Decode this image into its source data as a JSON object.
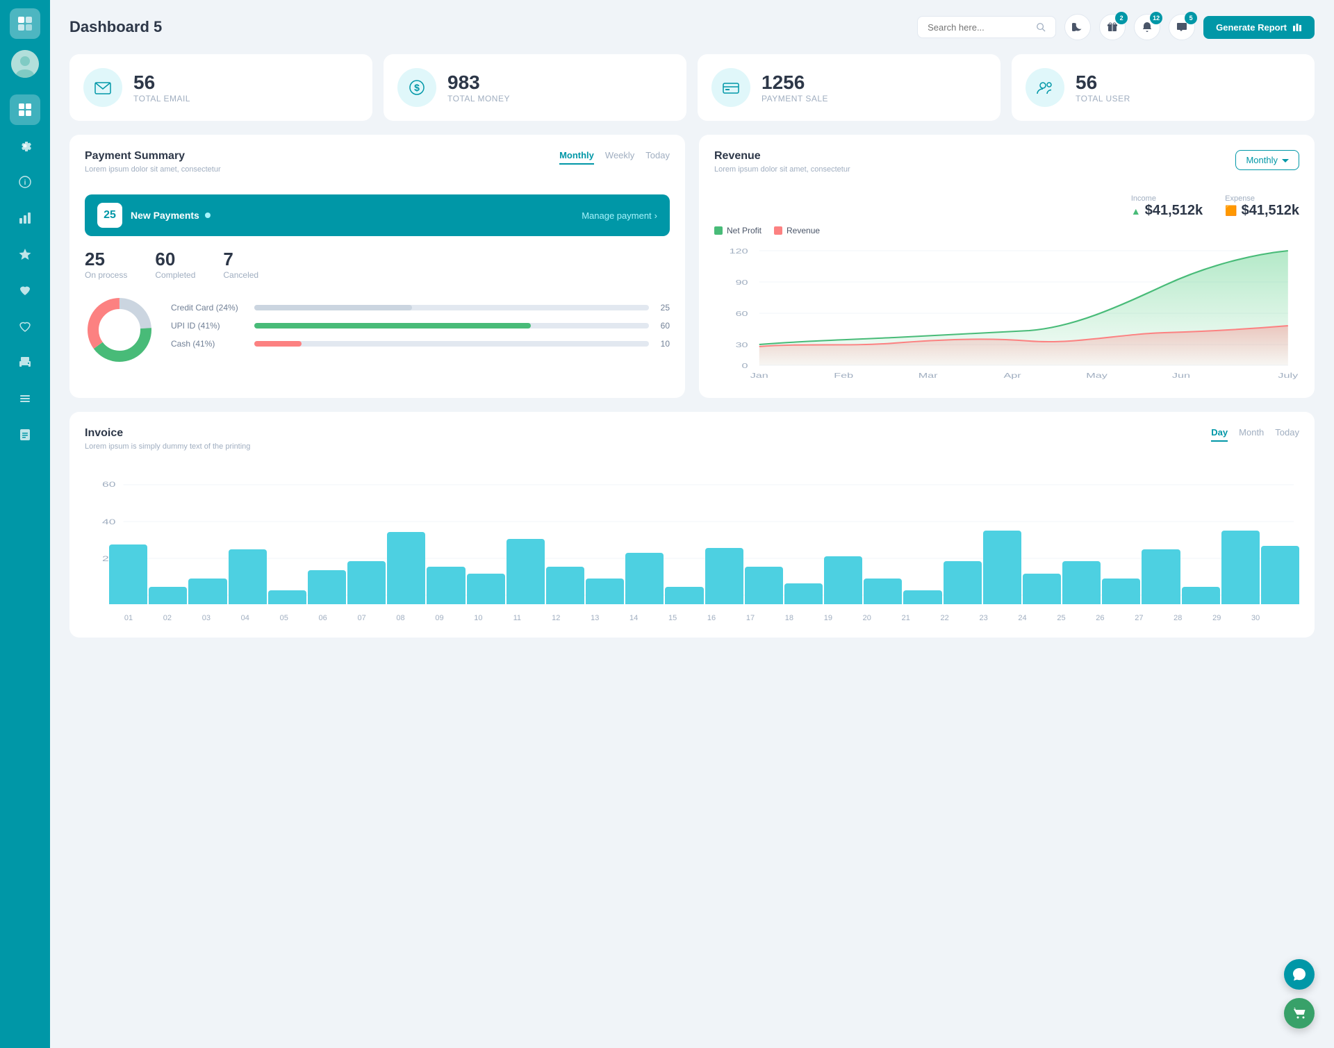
{
  "app": {
    "title": "Dashboard 5"
  },
  "header": {
    "search_placeholder": "Search here...",
    "generate_btn": "Generate Report",
    "badges": {
      "gift": "2",
      "bell": "12",
      "chat": "5"
    }
  },
  "stat_cards": [
    {
      "id": "email",
      "number": "56",
      "label": "TOTAL EMAIL",
      "icon": "📋"
    },
    {
      "id": "money",
      "number": "983",
      "label": "TOTAL MONEY",
      "icon": "💲"
    },
    {
      "id": "payment",
      "number": "1256",
      "label": "PAYMENT SALE",
      "icon": "💳"
    },
    {
      "id": "user",
      "number": "56",
      "label": "TOTAL USER",
      "icon": "👥"
    }
  ],
  "payment_summary": {
    "title": "Payment Summary",
    "subtitle": "Lorem ipsum dolor sit amet, consectetur",
    "tabs": [
      "Monthly",
      "Weekly",
      "Today"
    ],
    "active_tab": "Monthly",
    "new_payments_count": "25",
    "new_payments_label": "New Payments",
    "manage_link": "Manage payment",
    "stats": [
      {
        "number": "25",
        "label": "On process"
      },
      {
        "number": "60",
        "label": "Completed"
      },
      {
        "number": "7",
        "label": "Canceled"
      }
    ],
    "bars": [
      {
        "label": "Credit Card (24%)",
        "pct": 40,
        "color": "#cbd5e0",
        "value": "25"
      },
      {
        "label": "UPI ID (41%)",
        "pct": 70,
        "color": "#48bb78",
        "value": "60"
      },
      {
        "label": "Cash (41%)",
        "pct": 12,
        "color": "#fc8181",
        "value": "10"
      }
    ],
    "donut": {
      "segments": [
        {
          "color": "#cbd5e0",
          "pct": 24
        },
        {
          "color": "#48bb78",
          "pct": 41
        },
        {
          "color": "#fc8181",
          "pct": 35
        }
      ]
    }
  },
  "revenue": {
    "title": "Revenue",
    "subtitle": "Lorem ipsum dolor sit amet, consectetur",
    "active_tab": "Monthly",
    "income_label": "Income",
    "income_value": "$41,512k",
    "expense_label": "Expense",
    "expense_value": "$41,512k",
    "legend": [
      {
        "label": "Net Profit",
        "color": "#68d391"
      },
      {
        "label": "Revenue",
        "color": "#fc8181"
      }
    ],
    "x_labels": [
      "Jan",
      "Feb",
      "Mar",
      "Apr",
      "May",
      "Jun",
      "July"
    ],
    "y_labels": [
      "0",
      "30",
      "60",
      "90",
      "120"
    ]
  },
  "invoice": {
    "title": "Invoice",
    "subtitle": "Lorem ipsum is simply dummy text of the printing",
    "tabs": [
      "Day",
      "Month",
      "Today"
    ],
    "active_tab": "Day",
    "y_labels": [
      "0",
      "20",
      "40",
      "60"
    ],
    "x_labels": [
      "01",
      "02",
      "03",
      "04",
      "05",
      "06",
      "07",
      "08",
      "09",
      "10",
      "11",
      "12",
      "13",
      "14",
      "15",
      "16",
      "17",
      "18",
      "19",
      "20",
      "21",
      "22",
      "23",
      "24",
      "25",
      "26",
      "27",
      "28",
      "29",
      "30"
    ],
    "bars": [
      35,
      10,
      15,
      32,
      8,
      20,
      25,
      42,
      22,
      18,
      38,
      22,
      15,
      30,
      10,
      33,
      22,
      12,
      28,
      15,
      8,
      25,
      43,
      18,
      25,
      15,
      32,
      10,
      43,
      34
    ]
  },
  "sidebar": {
    "items": [
      {
        "icon": "▦",
        "id": "dashboard",
        "active": true
      },
      {
        "icon": "⚙",
        "id": "settings",
        "active": false
      },
      {
        "icon": "ℹ",
        "id": "info",
        "active": false
      },
      {
        "icon": "📊",
        "id": "analytics",
        "active": false
      },
      {
        "icon": "★",
        "id": "favorites",
        "active": false
      },
      {
        "icon": "♥",
        "id": "likes",
        "active": false
      },
      {
        "icon": "♡",
        "id": "wishlist",
        "active": false
      },
      {
        "icon": "🖨",
        "id": "print",
        "active": false
      },
      {
        "icon": "≡",
        "id": "menu",
        "active": false
      },
      {
        "icon": "📋",
        "id": "reports",
        "active": false
      }
    ]
  },
  "fab": [
    {
      "icon": "💬",
      "color": "#0097a7",
      "id": "chat"
    },
    {
      "icon": "🛒",
      "color": "#38a169",
      "id": "cart"
    }
  ]
}
